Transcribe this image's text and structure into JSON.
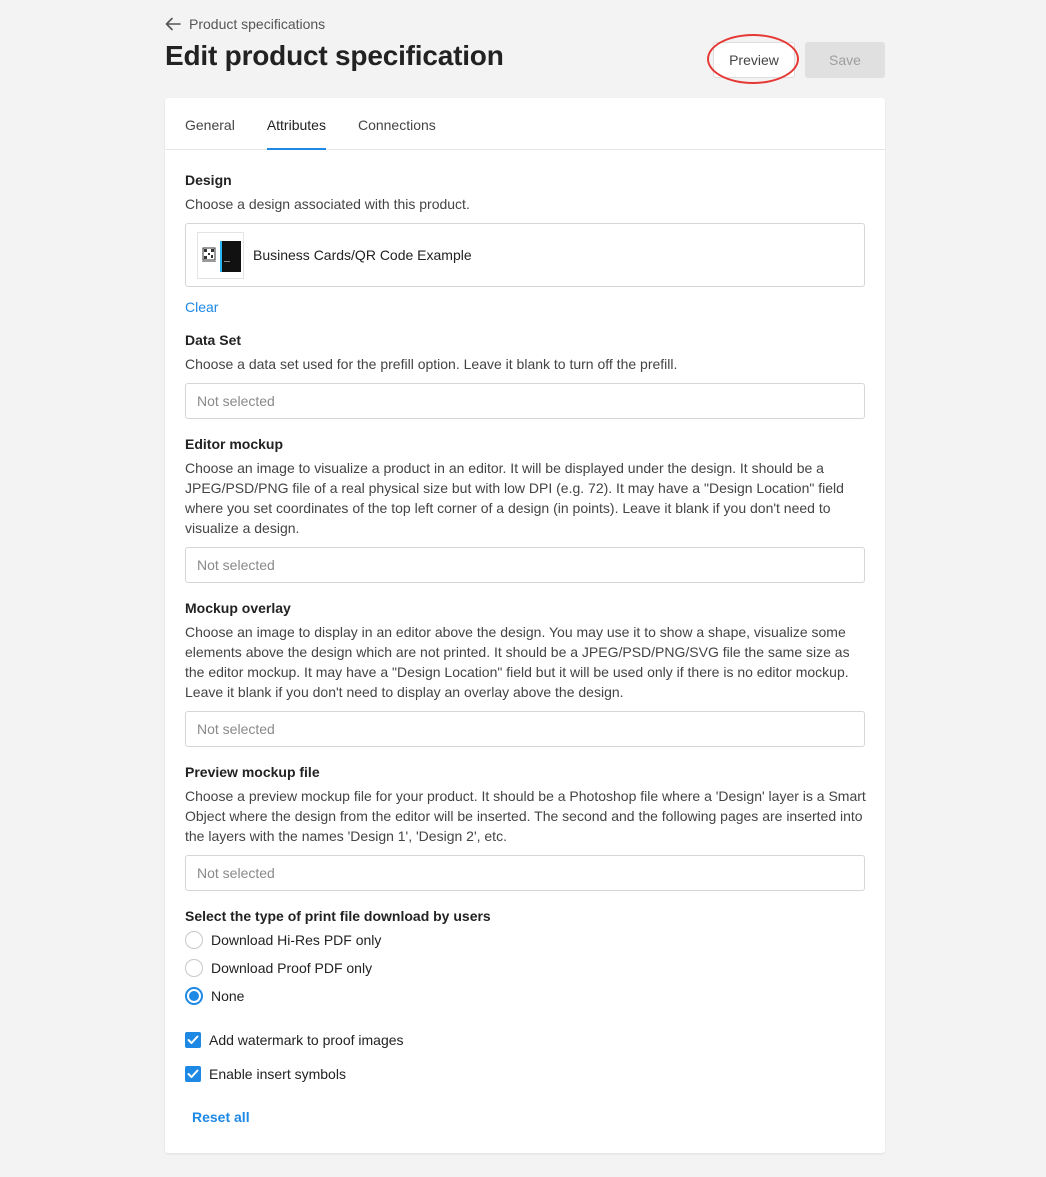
{
  "breadcrumb": {
    "label": "Product specifications"
  },
  "page_title": "Edit product specification",
  "buttons": {
    "preview": "Preview",
    "save": "Save"
  },
  "tabs": [
    {
      "label": "General",
      "active": false
    },
    {
      "label": "Attributes",
      "active": true
    },
    {
      "label": "Connections",
      "active": false
    }
  ],
  "design": {
    "title": "Design",
    "description": "Choose a design associated with this product.",
    "selected": "Business Cards/QR Code Example",
    "clear_label": "Clear"
  },
  "data_set": {
    "title": "Data Set",
    "description": "Choose a data set used for the prefill option. Leave it blank to turn off the prefill.",
    "placeholder": "Not selected"
  },
  "editor_mockup": {
    "title": "Editor mockup",
    "description": "Choose an image to visualize a product in an editor. It will be displayed under the design. It should be a JPEG/PSD/PNG file of a real physical size but with low DPI (e.g. 72). It may have a \"Design Location\" field where you set coordinates of the top left corner of a design (in points). Leave it blank if you don't need to visualize a design.",
    "placeholder": "Not selected"
  },
  "mockup_overlay": {
    "title": "Mockup overlay",
    "description": "Choose an image to display in an editor above the design. You may use it to show a shape, visualize some elements above the design which are not printed. It should be a JPEG/PSD/PNG/SVG file the same size as the editor mockup. It may have a \"Design Location\" field but it will be used only if there is no editor mockup. Leave it blank if you don't need to display an overlay above the design.",
    "placeholder": "Not selected"
  },
  "preview_mockup": {
    "title": "Preview mockup file",
    "description": "Choose a preview mockup file for your product. It should be a Photoshop file where a 'Design' layer is a Smart Object where the design from the editor will be inserted. The second and the following pages are inserted into the layers with the names 'Design 1', 'Design 2', etc.",
    "placeholder": "Not selected"
  },
  "print_download": {
    "title": "Select the type of print file download by users",
    "options": [
      {
        "label": "Download Hi-Res PDF only",
        "selected": false
      },
      {
        "label": "Download Proof PDF only",
        "selected": false
      },
      {
        "label": "None",
        "selected": true
      }
    ]
  },
  "checkboxes": [
    {
      "label": "Add watermark to proof images",
      "checked": true
    },
    {
      "label": "Enable insert symbols",
      "checked": true
    }
  ],
  "reset_label": "Reset all",
  "colors": {
    "accent": "#1e88e5",
    "highlight": "#e53935"
  }
}
